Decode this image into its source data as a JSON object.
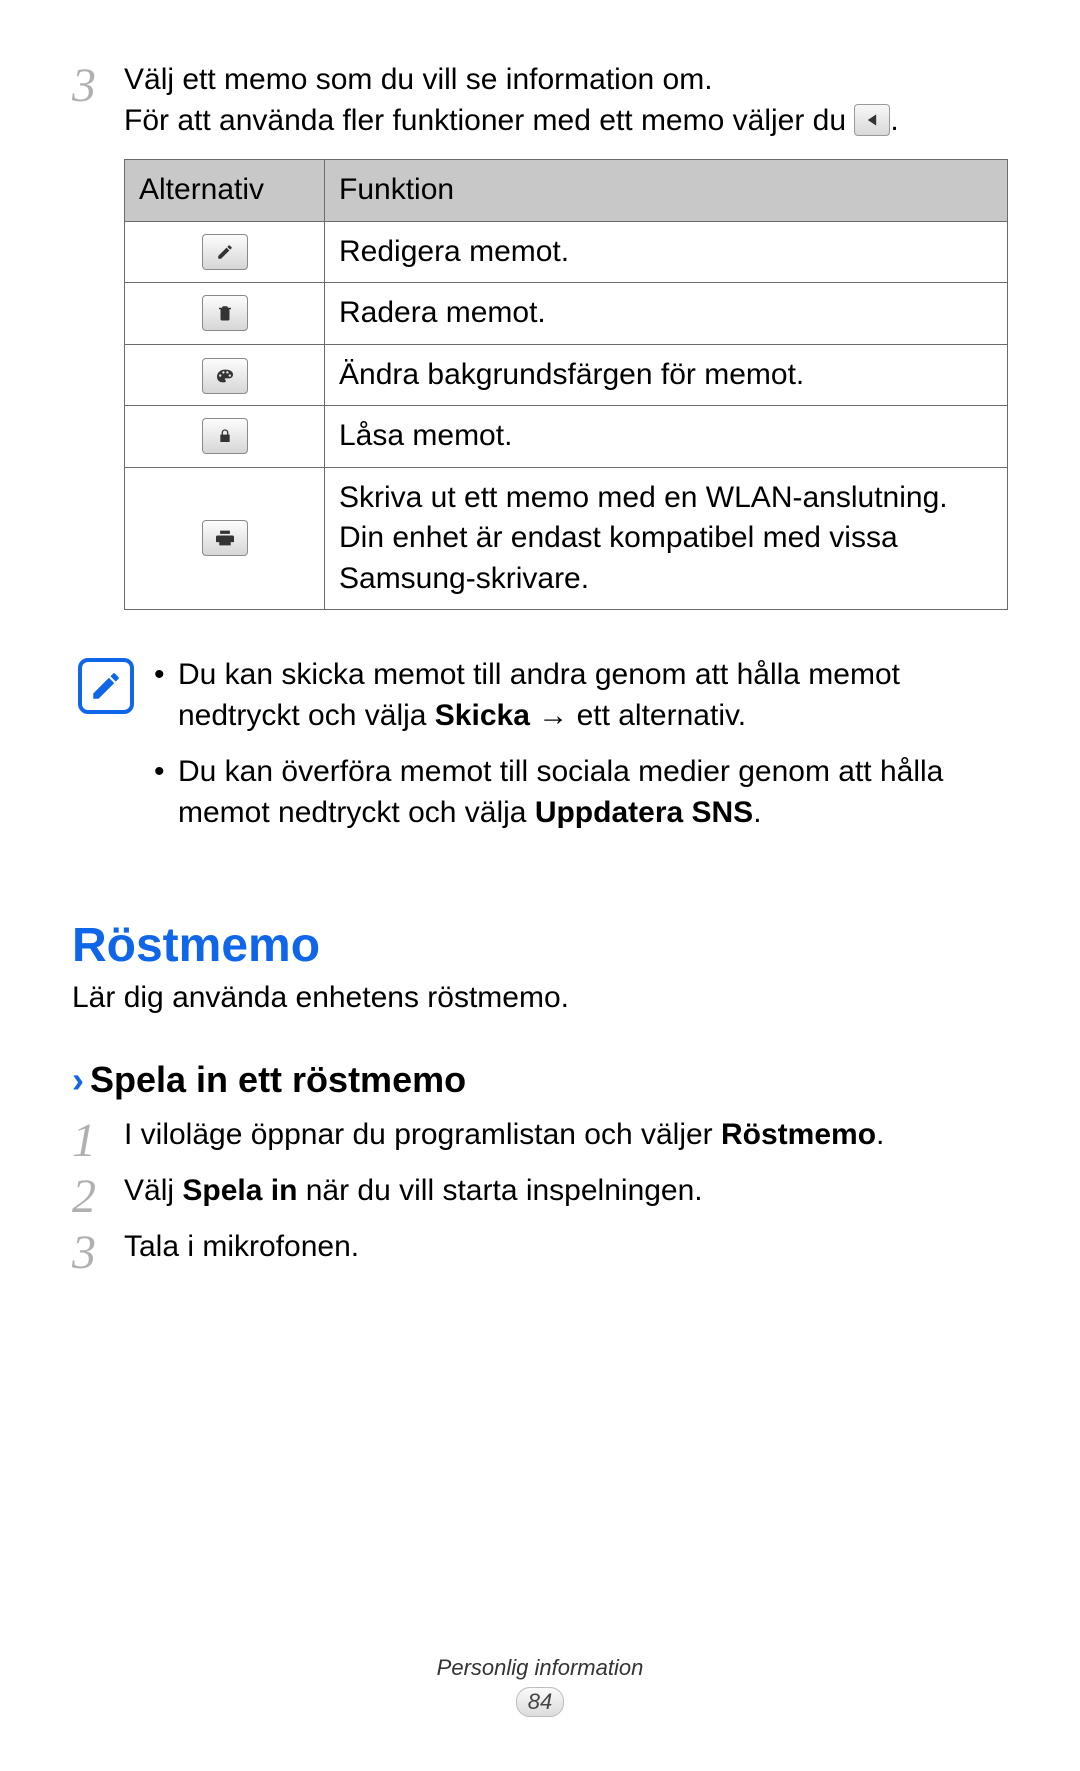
{
  "intro": {
    "step_number": "3",
    "line1": "Välj ett memo som du vill se information om.",
    "line2_pre": "För att använda fler funktioner med ett memo väljer du ",
    "line2_post": "."
  },
  "table": {
    "header_option": "Alternativ",
    "header_function": "Funktion",
    "rows": [
      {
        "icon": "pencil-icon",
        "text": "Redigera memot."
      },
      {
        "icon": "trash-icon",
        "text": "Radera memot."
      },
      {
        "icon": "palette-icon",
        "text": "Ändra bakgrundsfärgen för memot."
      },
      {
        "icon": "lock-icon",
        "text": "Låsa memot."
      },
      {
        "icon": "print-icon",
        "text": "Skriva ut ett memo med en WLAN-anslutning. Din enhet är endast kompatibel med vissa Samsung-skrivare."
      }
    ]
  },
  "note": {
    "item1_pre": "Du kan skicka memot till andra genom att hålla memot nedtryckt och välja ",
    "item1_bold": "Skicka",
    "item1_arrow": " → ",
    "item1_post": "ett alternativ.",
    "item2_pre": "Du kan överföra memot till sociala medier genom att hålla memot nedtryckt och välja ",
    "item2_bold": "Uppdatera SNS",
    "item2_post": "."
  },
  "section": {
    "title": "Röstmemo",
    "subtitle": "Lär dig använda enhetens röstmemo."
  },
  "subsection": {
    "title": "Spela in ett röstmemo",
    "steps": [
      {
        "n": "1",
        "pre": "I viloläge öppnar du programlistan och väljer ",
        "bold": "Röstmemo",
        "post": "."
      },
      {
        "n": "2",
        "pre": "Välj ",
        "bold": "Spela in",
        "post": " när du vill starta inspelningen."
      },
      {
        "n": "3",
        "pre": "Tala i mikrofonen.",
        "bold": "",
        "post": ""
      }
    ]
  },
  "footer": {
    "chapter": "Personlig information",
    "page": "84"
  }
}
